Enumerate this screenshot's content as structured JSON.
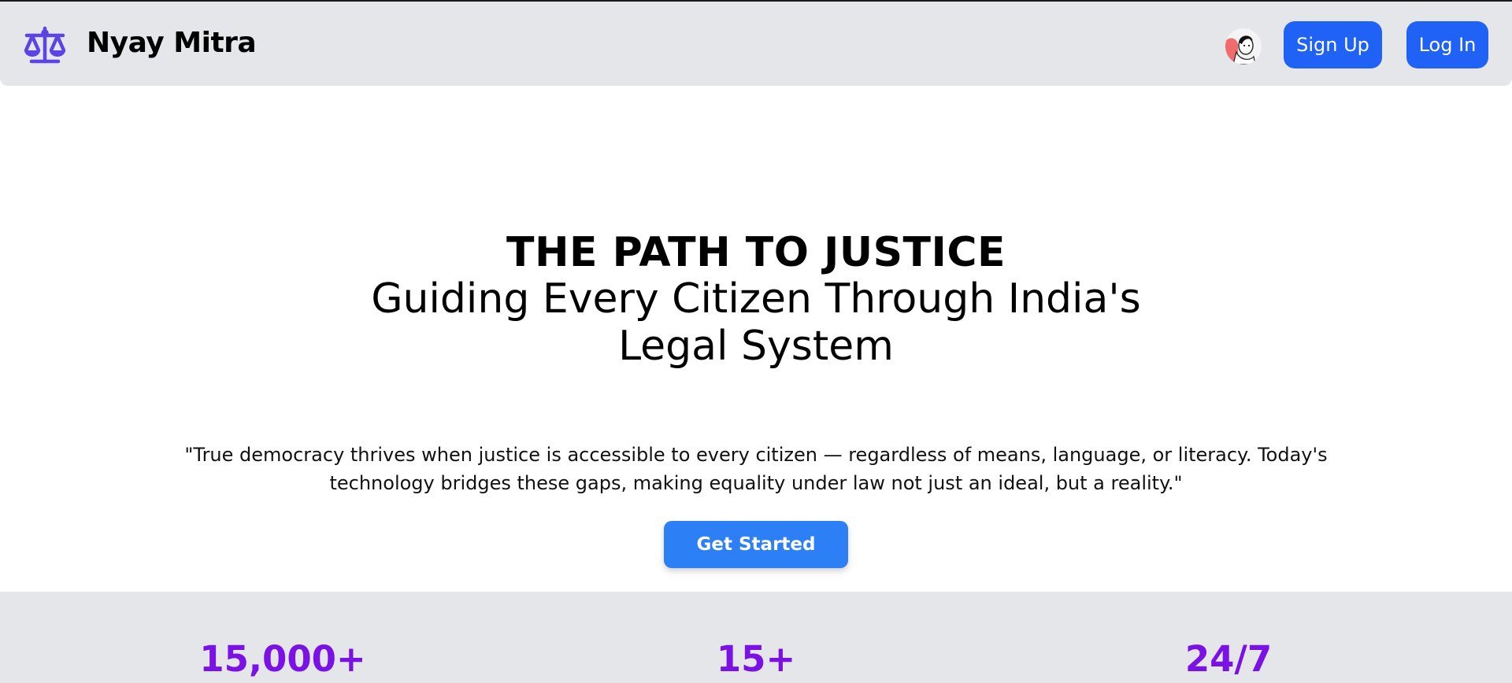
{
  "navbar": {
    "brand": "Nyay Mitra",
    "logo_icon": "scales-of-justice-icon",
    "signup_label": "Sign Up",
    "login_label": "Log In"
  },
  "hero": {
    "title": "THE PATH TO JUSTICE",
    "subtitle": "Guiding Every Citizen Through India's Legal System",
    "quote": "\"True democracy thrives when justice is accessible to every citizen — regardless of means, language, or literacy. Today's technology bridges these gaps, making equality under law not just an ideal, but a reality.\"",
    "cta_label": "Get Started"
  },
  "stats": [
    {
      "value": "15,000+"
    },
    {
      "value": "15+"
    },
    {
      "value": "24/7"
    }
  ],
  "colors": {
    "primary_button": "#1f62f5",
    "cta_button": "#2d7ff6",
    "stat_accent": "#7a12e6",
    "logo": "#5b43e6",
    "navbar_bg": "#e5e6ea"
  }
}
